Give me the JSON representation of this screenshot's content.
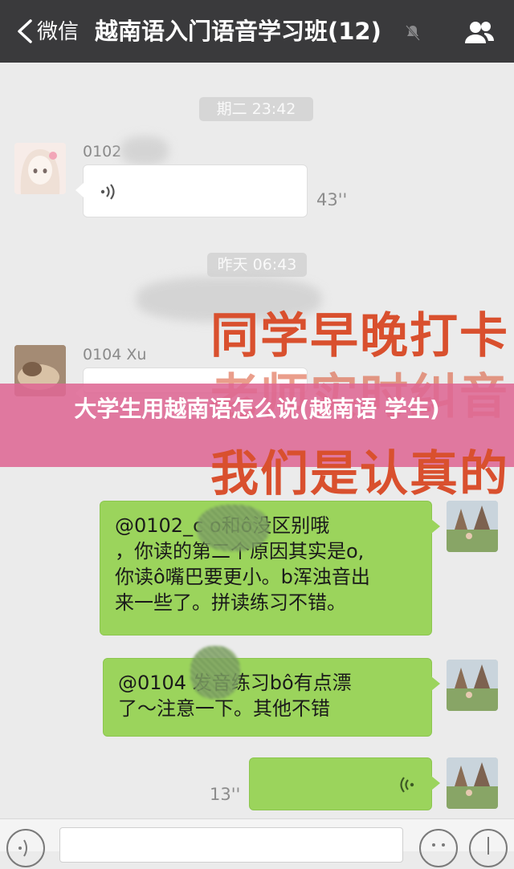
{
  "header": {
    "back_label": "微信",
    "title": "越南语入门语音学习班(12)"
  },
  "timestamps": [
    "期二 23:42",
    "昨天 06:43"
  ],
  "messages": [
    {
      "sender": "0102",
      "type": "voice",
      "duration": "43''"
    },
    {
      "sender": "0104 Xu",
      "type": "voice"
    },
    {
      "type": "text",
      "text_lines": [
        "@0102_c        o和ô没区别哦",
        "，你读的第二个原因其实是o,",
        "你读ô嘴巴要更小。b浑浊音出",
        "来一些了。拼读练习不错。"
      ]
    },
    {
      "type": "text",
      "text_lines": [
        "@0104          发音练习bô有点漂",
        "了～注意一下。其他不错"
      ]
    },
    {
      "type": "voice",
      "duration": "13''"
    }
  ],
  "overlay": {
    "lines": [
      "同学早晚打卡",
      "老师实时纠音",
      "我们是认真的"
    ],
    "color": "#d9502e"
  },
  "banner": {
    "text": "大学生用越南语怎么说(越南语 学生)",
    "color": "#de6894"
  },
  "colors": {
    "header_bg": "#3a3a3c",
    "sent_bubble": "#9bd45c",
    "chat_bg": "#ebebeb"
  }
}
